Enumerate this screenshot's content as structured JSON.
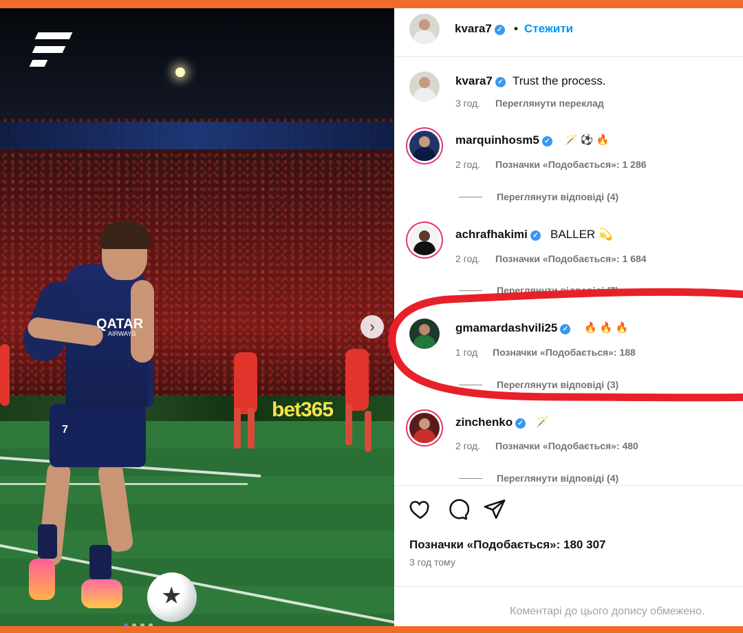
{
  "post": {
    "author": "kvara7",
    "follow_label": "Стежити",
    "separator": "•",
    "caption": "Trust the process.",
    "caption_time": "3 год.",
    "translation_label": "Переглянути переклад"
  },
  "comments": [
    {
      "username": "marquinhosm5",
      "text": "🪄 ⚽ 🔥",
      "time": "2 год.",
      "likes": "Позначки «Подобається»: 1 286",
      "replies": "Переглянути відповіді (4)"
    },
    {
      "username": "achrafhakimi",
      "text": "BALLER 💫",
      "time": "2 год.",
      "likes": "Позначки «Подобається»: 1 684",
      "replies": "Переглянути відповіді (7)"
    },
    {
      "username": "gmamardashvili25",
      "text": "🔥 🔥 🔥",
      "time": "1 год",
      "likes": "Позначки «Подобається»: 188",
      "replies": "Переглянути відповіді (3)"
    },
    {
      "username": "zinchenko",
      "text": "🪄",
      "time": "2 год.",
      "likes": "Позначки «Подобається»: 480",
      "replies": "Переглянути відповіді (4)"
    }
  ],
  "footer": {
    "likes": "Позначки «Подобається»: 180 307",
    "time": "3 год тому",
    "restricted_note": "Коментарі до цього допису обмежено."
  },
  "photo": {
    "sponsor": "QATAR",
    "sponsor_sub": "AIRWAYS",
    "shirt_number": "7",
    "ad_text": "bet365"
  },
  "colors": {
    "accent_orange": "#f26b2a",
    "verified_blue": "#3897f0",
    "follow_blue": "#0095f6",
    "highlight_red": "#e8202a"
  },
  "icons": [
    "brand-logo-icon",
    "chevron-right-icon",
    "verified-icon",
    "heart-icon",
    "comment-icon",
    "share-icon"
  ]
}
